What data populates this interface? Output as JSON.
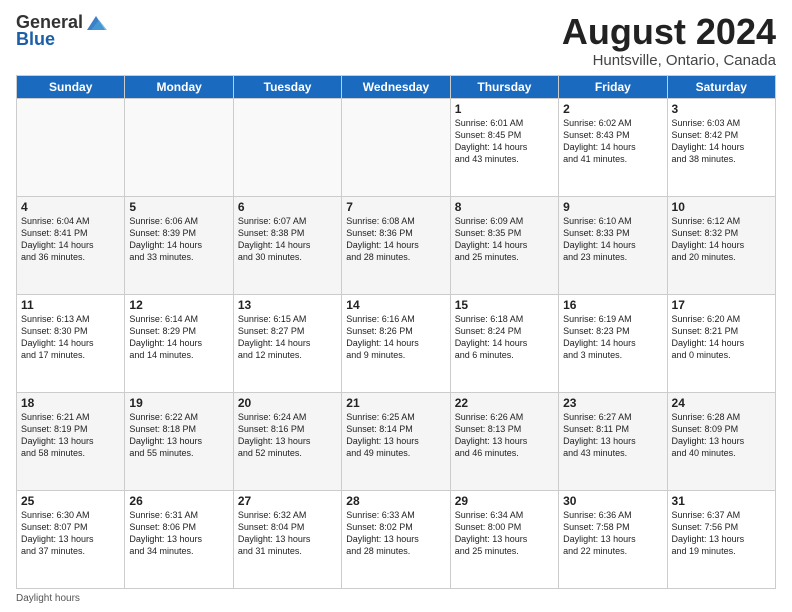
{
  "header": {
    "logo_general": "General",
    "logo_blue": "Blue",
    "title": "August 2024",
    "subtitle": "Huntsville, Ontario, Canada"
  },
  "weekdays": [
    "Sunday",
    "Monday",
    "Tuesday",
    "Wednesday",
    "Thursday",
    "Friday",
    "Saturday"
  ],
  "weeks": [
    [
      {
        "day": "",
        "info": ""
      },
      {
        "day": "",
        "info": ""
      },
      {
        "day": "",
        "info": ""
      },
      {
        "day": "",
        "info": ""
      },
      {
        "day": "1",
        "info": "Sunrise: 6:01 AM\nSunset: 8:45 PM\nDaylight: 14 hours\nand 43 minutes."
      },
      {
        "day": "2",
        "info": "Sunrise: 6:02 AM\nSunset: 8:43 PM\nDaylight: 14 hours\nand 41 minutes."
      },
      {
        "day": "3",
        "info": "Sunrise: 6:03 AM\nSunset: 8:42 PM\nDaylight: 14 hours\nand 38 minutes."
      }
    ],
    [
      {
        "day": "4",
        "info": "Sunrise: 6:04 AM\nSunset: 8:41 PM\nDaylight: 14 hours\nand 36 minutes."
      },
      {
        "day": "5",
        "info": "Sunrise: 6:06 AM\nSunset: 8:39 PM\nDaylight: 14 hours\nand 33 minutes."
      },
      {
        "day": "6",
        "info": "Sunrise: 6:07 AM\nSunset: 8:38 PM\nDaylight: 14 hours\nand 30 minutes."
      },
      {
        "day": "7",
        "info": "Sunrise: 6:08 AM\nSunset: 8:36 PM\nDaylight: 14 hours\nand 28 minutes."
      },
      {
        "day": "8",
        "info": "Sunrise: 6:09 AM\nSunset: 8:35 PM\nDaylight: 14 hours\nand 25 minutes."
      },
      {
        "day": "9",
        "info": "Sunrise: 6:10 AM\nSunset: 8:33 PM\nDaylight: 14 hours\nand 23 minutes."
      },
      {
        "day": "10",
        "info": "Sunrise: 6:12 AM\nSunset: 8:32 PM\nDaylight: 14 hours\nand 20 minutes."
      }
    ],
    [
      {
        "day": "11",
        "info": "Sunrise: 6:13 AM\nSunset: 8:30 PM\nDaylight: 14 hours\nand 17 minutes."
      },
      {
        "day": "12",
        "info": "Sunrise: 6:14 AM\nSunset: 8:29 PM\nDaylight: 14 hours\nand 14 minutes."
      },
      {
        "day": "13",
        "info": "Sunrise: 6:15 AM\nSunset: 8:27 PM\nDaylight: 14 hours\nand 12 minutes."
      },
      {
        "day": "14",
        "info": "Sunrise: 6:16 AM\nSunset: 8:26 PM\nDaylight: 14 hours\nand 9 minutes."
      },
      {
        "day": "15",
        "info": "Sunrise: 6:18 AM\nSunset: 8:24 PM\nDaylight: 14 hours\nand 6 minutes."
      },
      {
        "day": "16",
        "info": "Sunrise: 6:19 AM\nSunset: 8:23 PM\nDaylight: 14 hours\nand 3 minutes."
      },
      {
        "day": "17",
        "info": "Sunrise: 6:20 AM\nSunset: 8:21 PM\nDaylight: 14 hours\nand 0 minutes."
      }
    ],
    [
      {
        "day": "18",
        "info": "Sunrise: 6:21 AM\nSunset: 8:19 PM\nDaylight: 13 hours\nand 58 minutes."
      },
      {
        "day": "19",
        "info": "Sunrise: 6:22 AM\nSunset: 8:18 PM\nDaylight: 13 hours\nand 55 minutes."
      },
      {
        "day": "20",
        "info": "Sunrise: 6:24 AM\nSunset: 8:16 PM\nDaylight: 13 hours\nand 52 minutes."
      },
      {
        "day": "21",
        "info": "Sunrise: 6:25 AM\nSunset: 8:14 PM\nDaylight: 13 hours\nand 49 minutes."
      },
      {
        "day": "22",
        "info": "Sunrise: 6:26 AM\nSunset: 8:13 PM\nDaylight: 13 hours\nand 46 minutes."
      },
      {
        "day": "23",
        "info": "Sunrise: 6:27 AM\nSunset: 8:11 PM\nDaylight: 13 hours\nand 43 minutes."
      },
      {
        "day": "24",
        "info": "Sunrise: 6:28 AM\nSunset: 8:09 PM\nDaylight: 13 hours\nand 40 minutes."
      }
    ],
    [
      {
        "day": "25",
        "info": "Sunrise: 6:30 AM\nSunset: 8:07 PM\nDaylight: 13 hours\nand 37 minutes."
      },
      {
        "day": "26",
        "info": "Sunrise: 6:31 AM\nSunset: 8:06 PM\nDaylight: 13 hours\nand 34 minutes."
      },
      {
        "day": "27",
        "info": "Sunrise: 6:32 AM\nSunset: 8:04 PM\nDaylight: 13 hours\nand 31 minutes."
      },
      {
        "day": "28",
        "info": "Sunrise: 6:33 AM\nSunset: 8:02 PM\nDaylight: 13 hours\nand 28 minutes."
      },
      {
        "day": "29",
        "info": "Sunrise: 6:34 AM\nSunset: 8:00 PM\nDaylight: 13 hours\nand 25 minutes."
      },
      {
        "day": "30",
        "info": "Sunrise: 6:36 AM\nSunset: 7:58 PM\nDaylight: 13 hours\nand 22 minutes."
      },
      {
        "day": "31",
        "info": "Sunrise: 6:37 AM\nSunset: 7:56 PM\nDaylight: 13 hours\nand 19 minutes."
      }
    ]
  ],
  "footer": {
    "note": "Daylight hours"
  }
}
